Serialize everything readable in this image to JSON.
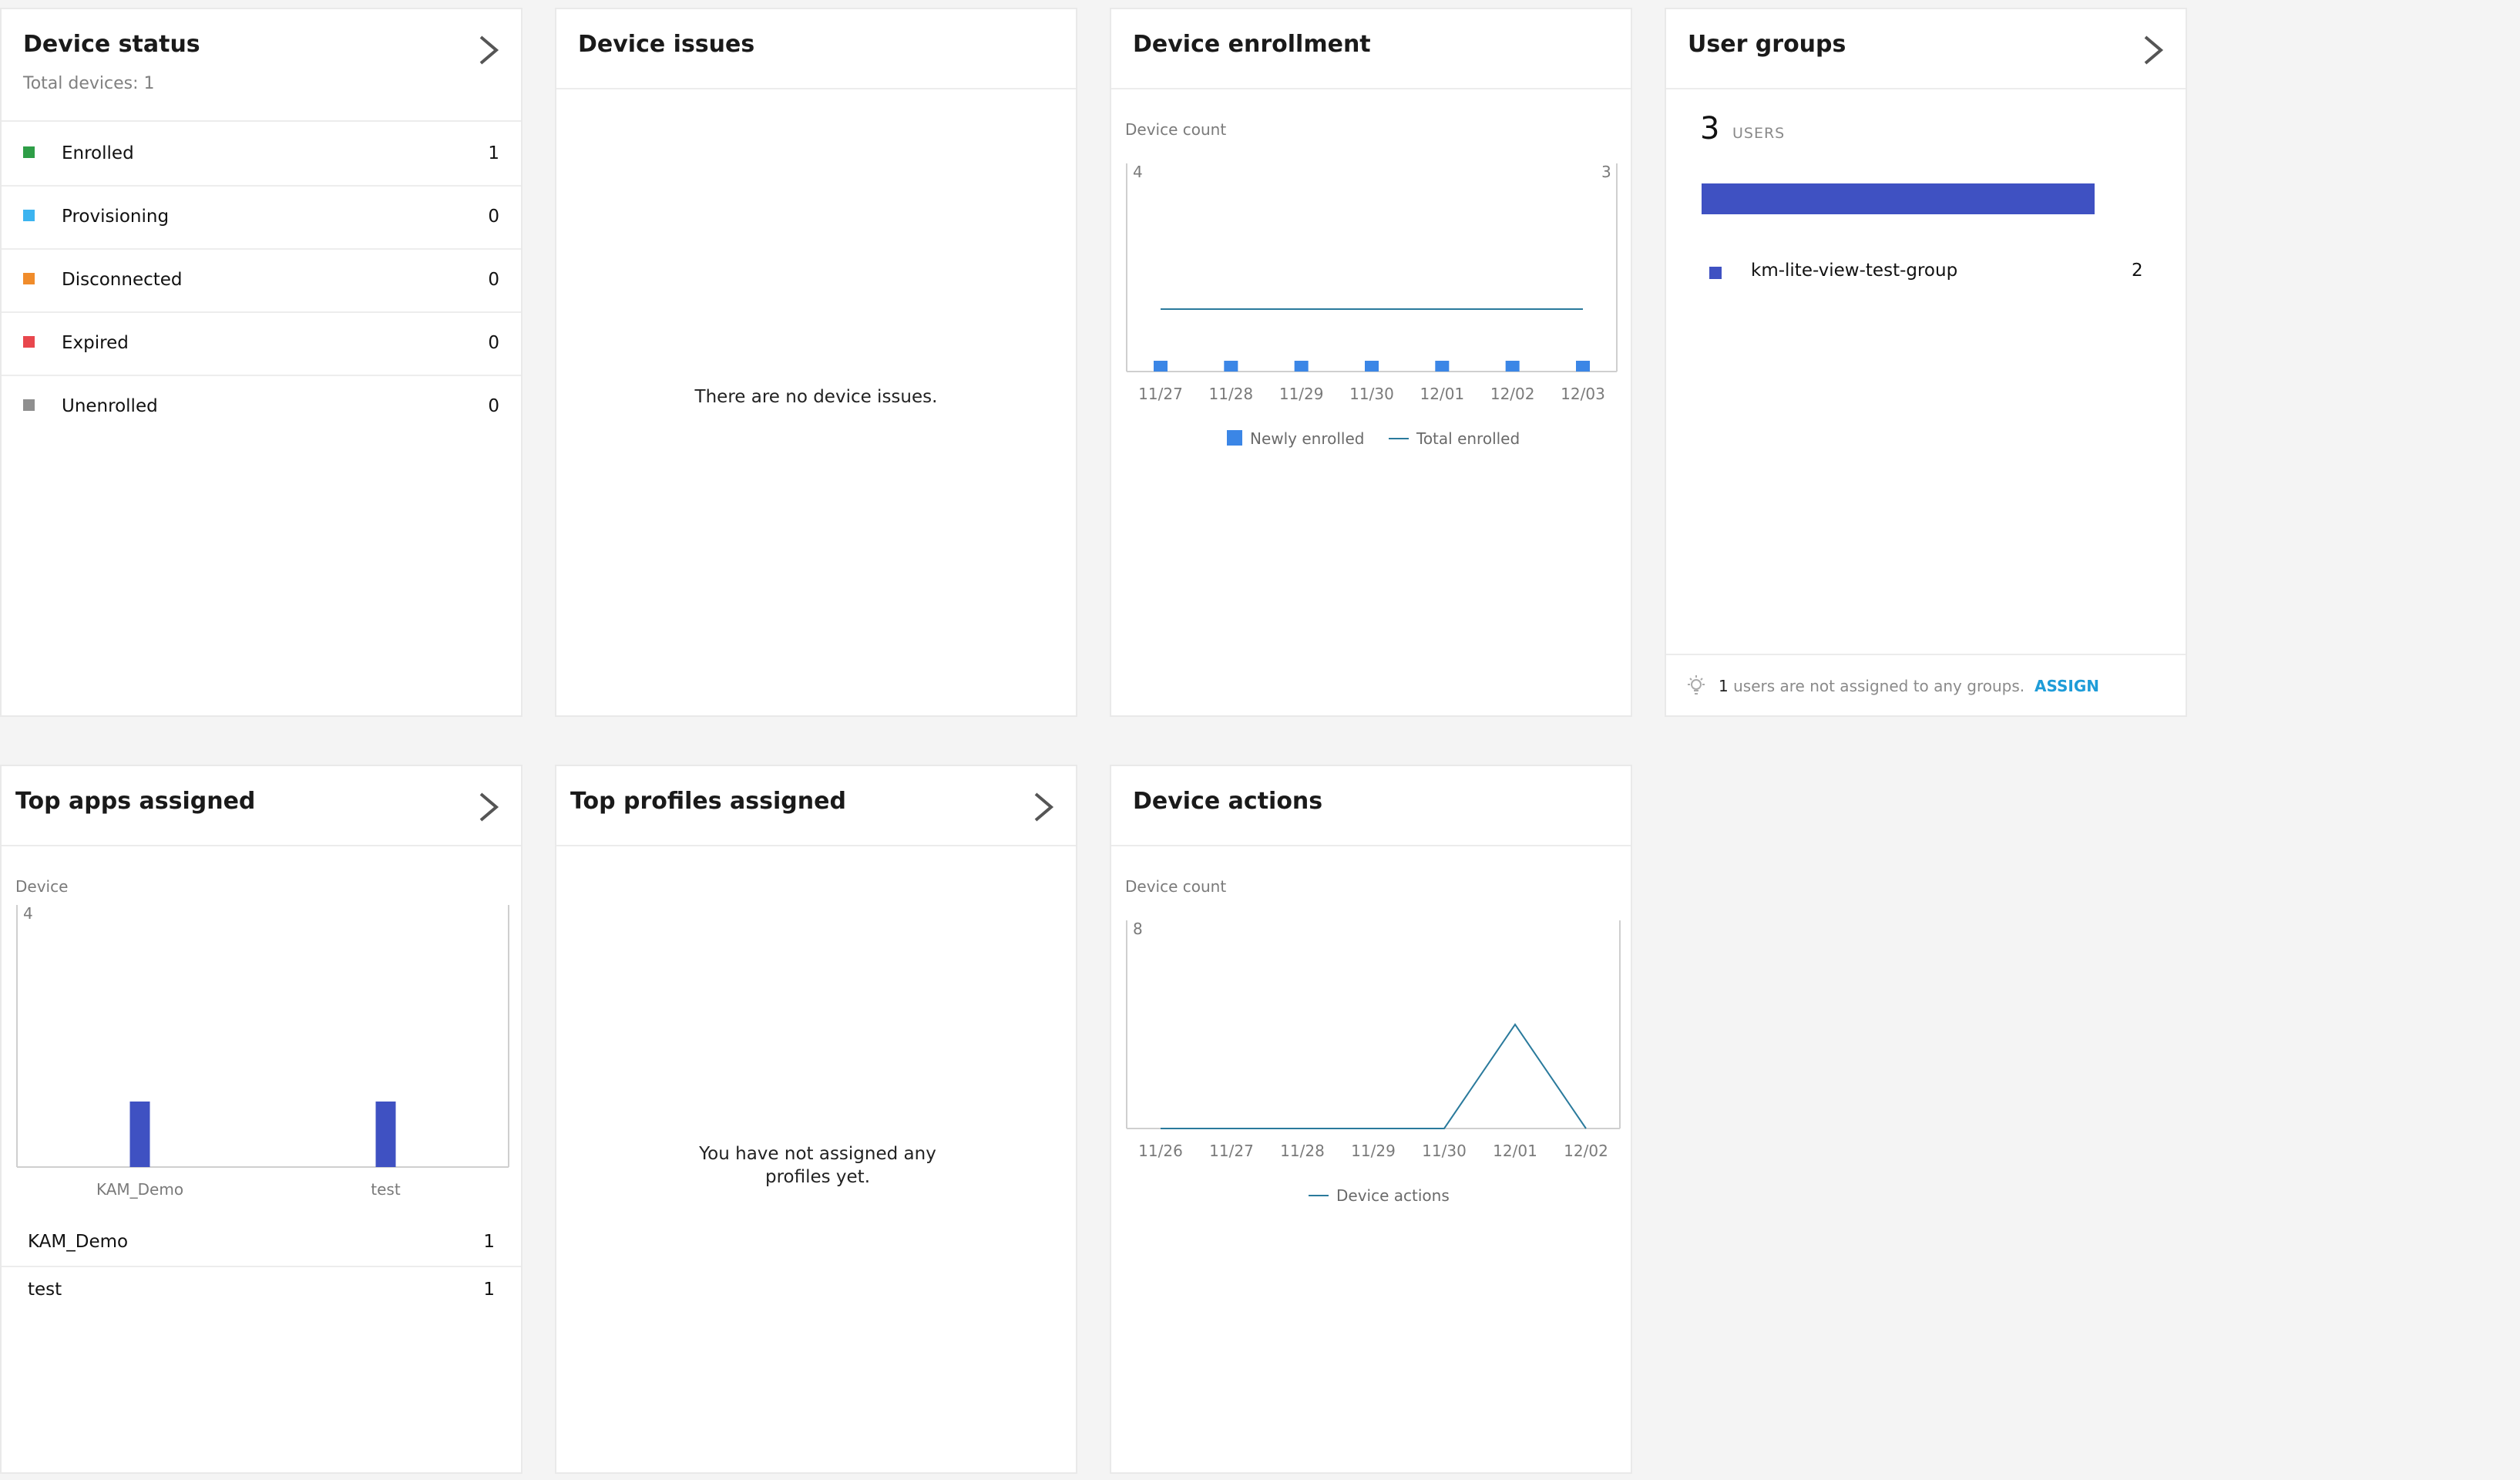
{
  "colors": {
    "enrolled": "#2e9e47",
    "provisioning": "#3cb4f0",
    "disconnected": "#f08c2b",
    "expired": "#e8474d",
    "unenrolled": "#8f8f8f",
    "bar_blue": "#3b86e6",
    "line_teal": "#2a7a9c",
    "indigo": "#3f51c2",
    "link": "#1e9cd8"
  },
  "device_status": {
    "title": "Device status",
    "subtitle": "Total devices: 1",
    "icon": "chevron-right-icon",
    "items": [
      {
        "label": "Enrolled",
        "count": "1"
      },
      {
        "label": "Provisioning",
        "count": "0"
      },
      {
        "label": "Disconnected",
        "count": "0"
      },
      {
        "label": "Expired",
        "count": "0"
      },
      {
        "label": "Unenrolled",
        "count": "0"
      }
    ]
  },
  "device_issues": {
    "title": "Device issues",
    "empty_message": "There are no device issues."
  },
  "device_enrollment": {
    "title": "Device enrollment",
    "axis_title": "Device count"
  },
  "user_groups": {
    "title": "User groups",
    "icon": "chevron-right-icon",
    "total": "3",
    "unit": "USERS",
    "groups": [
      {
        "name": "km-lite-view-test-group",
        "count": "2"
      }
    ],
    "footer_count": "1",
    "footer_text": "users are not assigned to any groups.",
    "assign_label": "ASSIGN"
  },
  "top_apps": {
    "title": "Top apps assigned",
    "icon": "chevron-right-icon",
    "axis_title": "Device",
    "list": [
      {
        "name": "KAM_Demo",
        "count": "1"
      },
      {
        "name": "test",
        "count": "1"
      }
    ]
  },
  "top_profiles": {
    "title": "Top profiles assigned",
    "icon": "chevron-right-icon",
    "empty_message": "You have not assigned any profiles yet."
  },
  "device_actions": {
    "title": "Device actions",
    "axis_title": "Device count"
  },
  "chart_data": [
    {
      "id": "enrollment",
      "type": "bar",
      "categories": [
        "11/27",
        "11/28",
        "11/29",
        "11/30",
        "12/01",
        "12/02",
        "12/03"
      ],
      "series": [
        {
          "name": "Newly enrolled",
          "kind": "bar",
          "axis": "left",
          "values": [
            0,
            0,
            0,
            0,
            0,
            0,
            0
          ]
        },
        {
          "name": "Total enrolled",
          "kind": "line",
          "axis": "right",
          "values": [
            1,
            1,
            1,
            1,
            1,
            1,
            1
          ]
        }
      ],
      "ylabel": "Device count",
      "ylim": [
        0,
        4
      ],
      "y2lim": [
        0,
        3
      ],
      "ytick_label": "4",
      "y2tick_label": "3",
      "legend": "bottom",
      "grid": false
    },
    {
      "id": "top_apps",
      "type": "bar",
      "categories": [
        "KAM_Demo",
        "test"
      ],
      "series": [
        {
          "name": "",
          "values": [
            1,
            1
          ]
        }
      ],
      "ylabel": "Device",
      "ylim": [
        0,
        4
      ],
      "ytick_label": "4",
      "grid": false
    },
    {
      "id": "device_actions",
      "type": "line",
      "categories": [
        "11/26",
        "11/27",
        "11/28",
        "11/29",
        "11/30",
        "12/01",
        "12/02"
      ],
      "series": [
        {
          "name": "Device actions",
          "values": [
            0,
            0,
            0,
            0,
            0,
            4,
            0
          ]
        }
      ],
      "ylabel": "Device count",
      "ylim": [
        0,
        8
      ],
      "ytick_label": "8",
      "legend": "bottom",
      "grid": false
    }
  ]
}
